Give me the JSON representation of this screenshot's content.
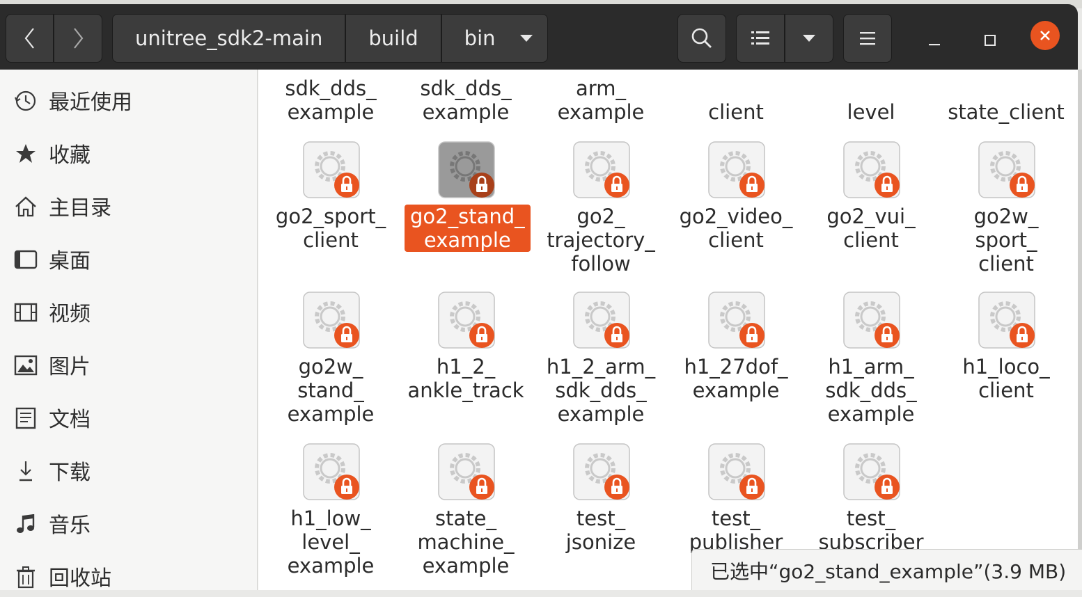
{
  "header": {
    "breadcrumbs": [
      "unitree_sdk2-main",
      "build",
      "bin"
    ]
  },
  "sidebar": {
    "items": [
      {
        "label": "最近使用",
        "icon": "clock-icon"
      },
      {
        "label": "收藏",
        "icon": "star-icon"
      },
      {
        "label": "主目录",
        "icon": "home-icon"
      },
      {
        "label": "桌面",
        "icon": "desktop-icon"
      },
      {
        "label": "视频",
        "icon": "film-icon"
      },
      {
        "label": "图片",
        "icon": "picture-icon"
      },
      {
        "label": "文档",
        "icon": "document-icon"
      },
      {
        "label": "下载",
        "icon": "download-icon"
      },
      {
        "label": "音乐",
        "icon": "music-note-icon"
      },
      {
        "label": "回收站",
        "icon": "trash-icon"
      }
    ]
  },
  "files_partial_row": [
    "sdk_dds_\nexample",
    "sdk_dds_\nexample",
    "arm_\nexample",
    "client",
    "level",
    "state_client"
  ],
  "files": [
    "go2_sport_\nclient",
    "go2_stand_\nexample",
    "go2_\ntrajectory_\nfollow",
    "go2_video_\nclient",
    "go2_vui_\nclient",
    "go2w_\nsport_\nclient",
    "go2w_\nstand_\nexample",
    "h1_2_\nankle_track",
    "h1_2_arm_\nsdk_dds_\nexample",
    "h1_27dof_\nexample",
    "h1_arm_\nsdk_dds_\nexample",
    "h1_loco_\nclient",
    "h1_low_\nlevel_\nexample",
    "state_\nmachine_\nexample",
    "test_\njsonize",
    "test_\npublisher",
    "test_\nsubscriber"
  ],
  "selected_file": "go2_stand_\nexample",
  "status_text": "已选中“go2_stand_example”(3.9 MB)",
  "colors": {
    "accent": "#e95420",
    "headerbar": "#2b2b2b"
  }
}
